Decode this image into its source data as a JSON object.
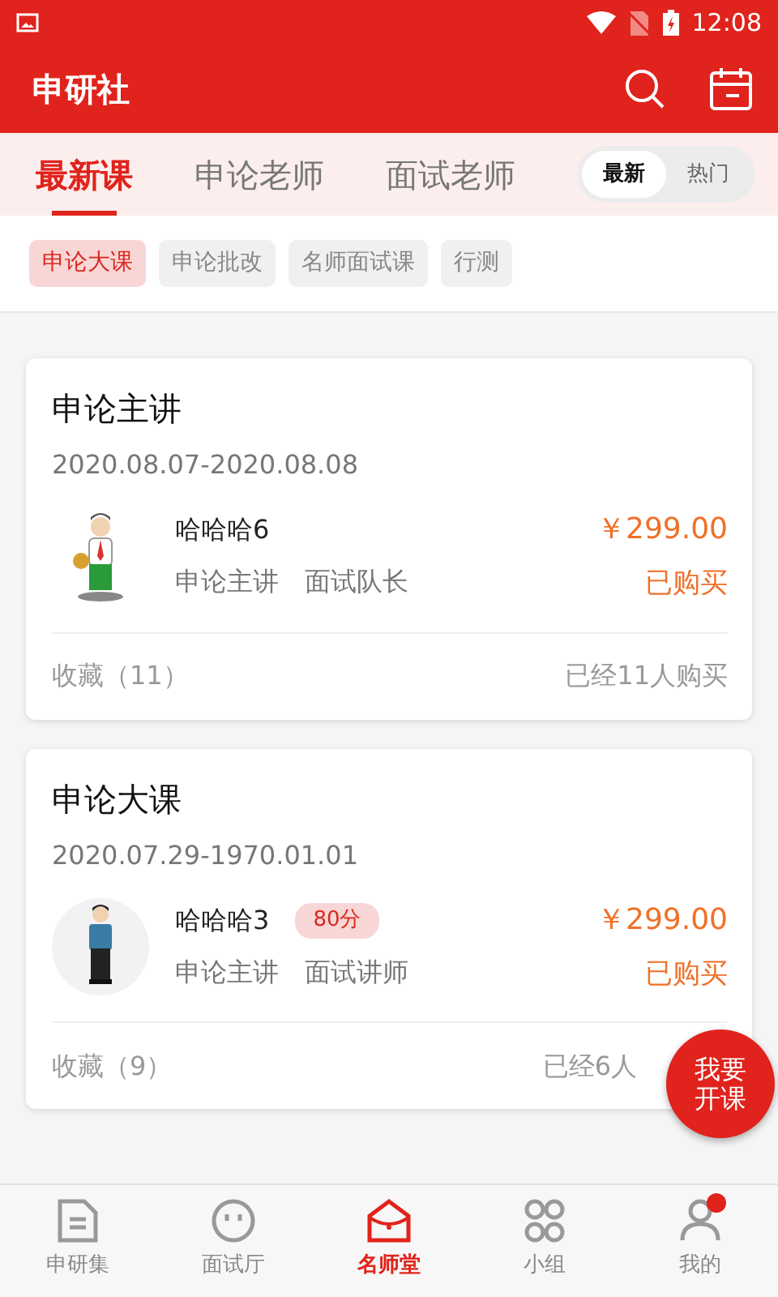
{
  "status_bar": {
    "time": "12:08"
  },
  "app_bar": {
    "title": "申研社"
  },
  "tabs": [
    {
      "label": "最新课",
      "selected": true
    },
    {
      "label": "申论老师",
      "selected": false
    },
    {
      "label": "面试老师",
      "selected": false
    }
  ],
  "sort_toggle": [
    {
      "label": "最新",
      "selected": true
    },
    {
      "label": "热门",
      "selected": false
    }
  ],
  "chips": [
    {
      "label": "申论大课",
      "selected": true
    },
    {
      "label": "申论批改",
      "selected": false
    },
    {
      "label": "名师面试课",
      "selected": false
    },
    {
      "label": "行测",
      "selected": false
    }
  ],
  "courses": [
    {
      "title": "申论主讲",
      "dates": "2020.08.07-2020.08.08",
      "teacher": "哈哈哈6",
      "roles": [
        "申论主讲",
        "面试队长"
      ],
      "price": "￥299.00",
      "status": "已购买",
      "favorites": "收藏（11）",
      "buyers": "已经11人购买",
      "avatar": {
        "kind": "picture"
      }
    },
    {
      "title": "申论大课",
      "dates": "2020.07.29-1970.01.01",
      "teacher": "哈哈哈3",
      "score": "80分",
      "roles": [
        "申论主讲",
        "面试讲师"
      ],
      "price": "￥299.00",
      "status": "已购买",
      "favorites": "收藏（9）",
      "buyers": "已经6人",
      "avatar": {
        "kind": "picture"
      }
    }
  ],
  "fab": {
    "label": "我要开课"
  },
  "bottom_nav": [
    {
      "label": "申研集",
      "kind": "doc",
      "selected": false,
      "dot": false
    },
    {
      "label": "面试厅",
      "kind": "face",
      "selected": false,
      "dot": false
    },
    {
      "label": "名师堂",
      "kind": "house",
      "selected": true,
      "dot": false
    },
    {
      "label": "小组",
      "kind": "group",
      "selected": false,
      "dot": false
    },
    {
      "label": "我的",
      "kind": "person",
      "selected": false,
      "dot": true
    }
  ]
}
